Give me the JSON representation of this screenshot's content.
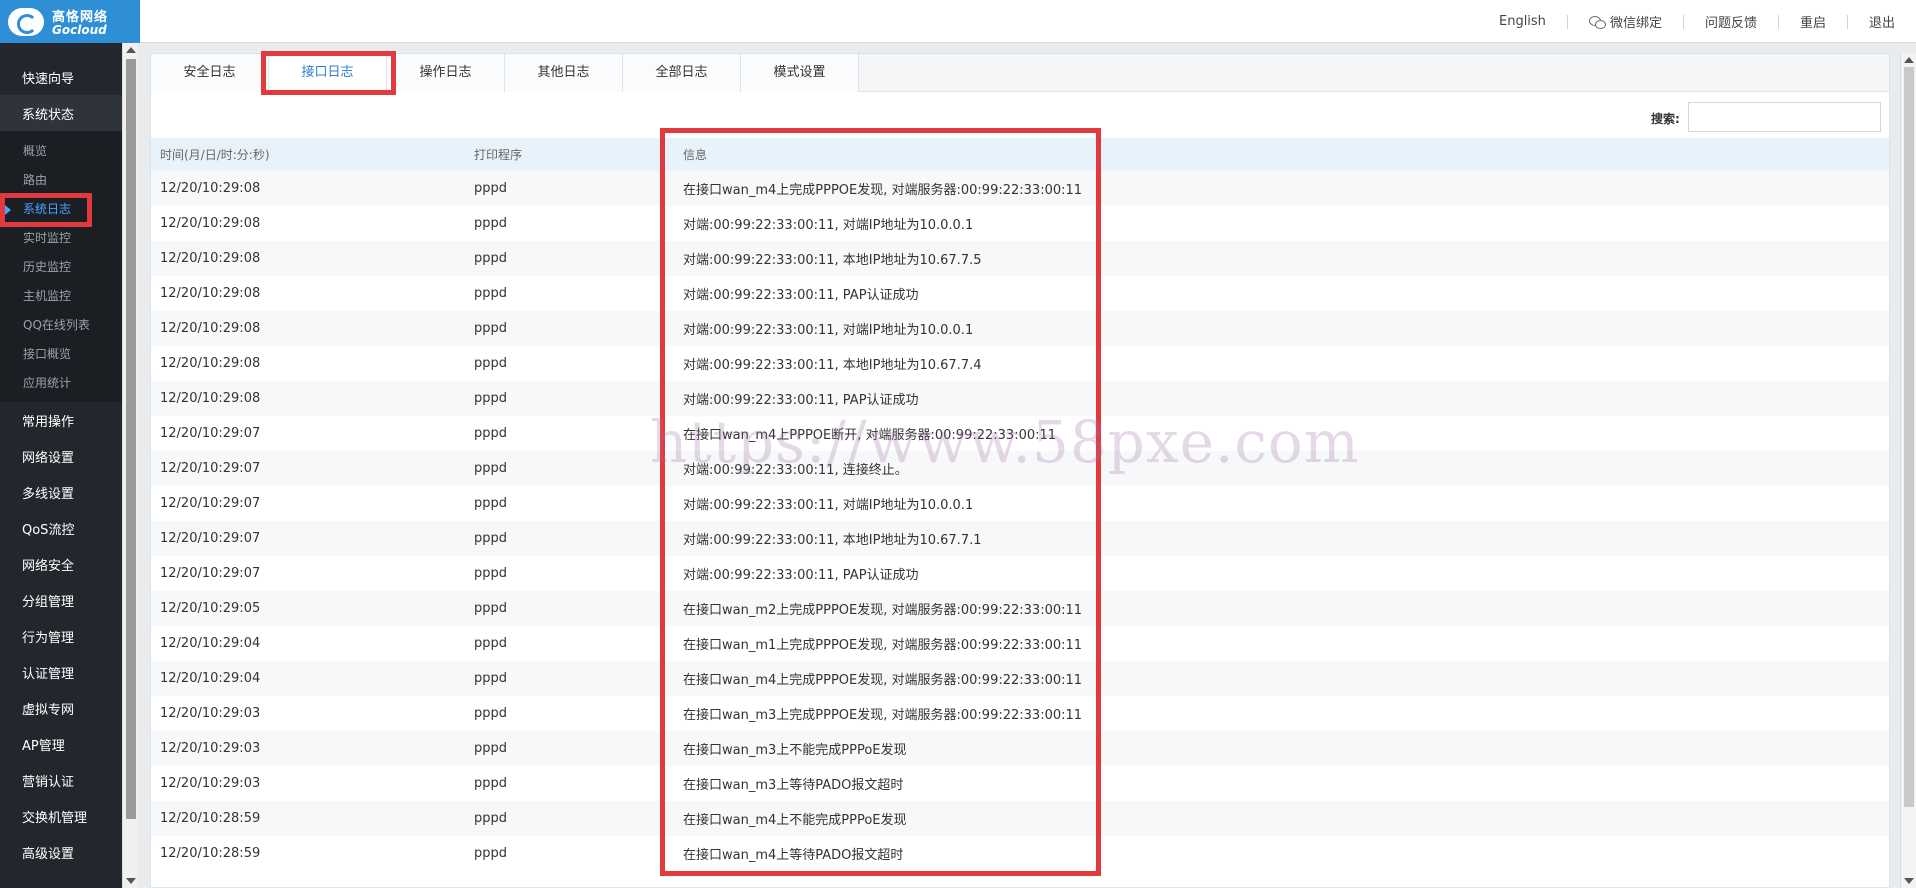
{
  "brand": {
    "name_cn": "高恪网络",
    "name_en": "Gocloud",
    "color": "#2f8fd6"
  },
  "topnav": [
    {
      "label": "English",
      "icon": ""
    },
    {
      "label": "微信绑定",
      "icon": "wechat-icon"
    },
    {
      "label": "问题反馈",
      "icon": ""
    },
    {
      "label": "重启",
      "icon": ""
    },
    {
      "label": "退出",
      "icon": ""
    }
  ],
  "sidebar": {
    "groups": [
      {
        "label": "快速向导"
      },
      {
        "label": "系统状态",
        "open": true,
        "items": [
          {
            "label": "概览"
          },
          {
            "label": "路由"
          },
          {
            "label": "系统日志",
            "active": true
          },
          {
            "label": "实时监控"
          },
          {
            "label": "历史监控"
          },
          {
            "label": "主机监控"
          },
          {
            "label": "QQ在线列表"
          },
          {
            "label": "接口概览"
          },
          {
            "label": "应用统计"
          }
        ]
      },
      {
        "label": "常用操作"
      },
      {
        "label": "网络设置"
      },
      {
        "label": "多线设置"
      },
      {
        "label": "QoS流控"
      },
      {
        "label": "网络安全"
      },
      {
        "label": "分组管理"
      },
      {
        "label": "行为管理"
      },
      {
        "label": "认证管理"
      },
      {
        "label": "虚拟专网"
      },
      {
        "label": "AP管理"
      },
      {
        "label": "营销认证"
      },
      {
        "label": "交换机管理"
      },
      {
        "label": "高级设置"
      }
    ]
  },
  "tabs": [
    {
      "label": "安全日志"
    },
    {
      "label": "接口日志",
      "active": true
    },
    {
      "label": "操作日志"
    },
    {
      "label": "其他日志"
    },
    {
      "label": "全部日志"
    },
    {
      "label": "模式设置"
    }
  ],
  "search": {
    "label": "搜索:",
    "value": ""
  },
  "table": {
    "columns": [
      "时间(月/日/时:分:秒)",
      "打印程序",
      "信息"
    ],
    "rows": [
      [
        "12/20/10:29:08",
        "pppd",
        "在接口wan_m4上完成PPPOE发现, 对端服务器:00:99:22:33:00:11"
      ],
      [
        "12/20/10:29:08",
        "pppd",
        "对端:00:99:22:33:00:11, 对端IP地址为10.0.0.1"
      ],
      [
        "12/20/10:29:08",
        "pppd",
        "对端:00:99:22:33:00:11, 本地IP地址为10.67.7.5"
      ],
      [
        "12/20/10:29:08",
        "pppd",
        "对端:00:99:22:33:00:11, PAP认证成功"
      ],
      [
        "12/20/10:29:08",
        "pppd",
        "对端:00:99:22:33:00:11, 对端IP地址为10.0.0.1"
      ],
      [
        "12/20/10:29:08",
        "pppd",
        "对端:00:99:22:33:00:11, 本地IP地址为10.67.7.4"
      ],
      [
        "12/20/10:29:08",
        "pppd",
        "对端:00:99:22:33:00:11, PAP认证成功"
      ],
      [
        "12/20/10:29:07",
        "pppd",
        "在接口wan_m4上PPPOE断开, 对端服务器:00:99:22:33:00:11"
      ],
      [
        "12/20/10:29:07",
        "pppd",
        "对端:00:99:22:33:00:11, 连接终止。"
      ],
      [
        "12/20/10:29:07",
        "pppd",
        "对端:00:99:22:33:00:11, 对端IP地址为10.0.0.1"
      ],
      [
        "12/20/10:29:07",
        "pppd",
        "对端:00:99:22:33:00:11, 本地IP地址为10.67.7.1"
      ],
      [
        "12/20/10:29:07",
        "pppd",
        "对端:00:99:22:33:00:11, PAP认证成功"
      ],
      [
        "12/20/10:29:05",
        "pppd",
        "在接口wan_m2上完成PPPOE发现, 对端服务器:00:99:22:33:00:11"
      ],
      [
        "12/20/10:29:04",
        "pppd",
        "在接口wan_m1上完成PPPOE发现, 对端服务器:00:99:22:33:00:11"
      ],
      [
        "12/20/10:29:04",
        "pppd",
        "在接口wan_m4上完成PPPOE发现, 对端服务器:00:99:22:33:00:11"
      ],
      [
        "12/20/10:29:03",
        "pppd",
        "在接口wan_m3上完成PPPOE发现, 对端服务器:00:99:22:33:00:11"
      ],
      [
        "12/20/10:29:03",
        "pppd",
        "在接口wan_m3上不能完成PPPoE发现"
      ],
      [
        "12/20/10:29:03",
        "pppd",
        "在接口wan_m3上等待PADO报文超时"
      ],
      [
        "12/20/10:28:59",
        "pppd",
        "在接口wan_m4上不能完成PPPoE发现"
      ],
      [
        "12/20/10:28:59",
        "pppd",
        "在接口wan_m4上等待PADO报文超时"
      ]
    ]
  },
  "watermark": "https://www.58pxe.com",
  "annotation_color": "#e03a3e"
}
